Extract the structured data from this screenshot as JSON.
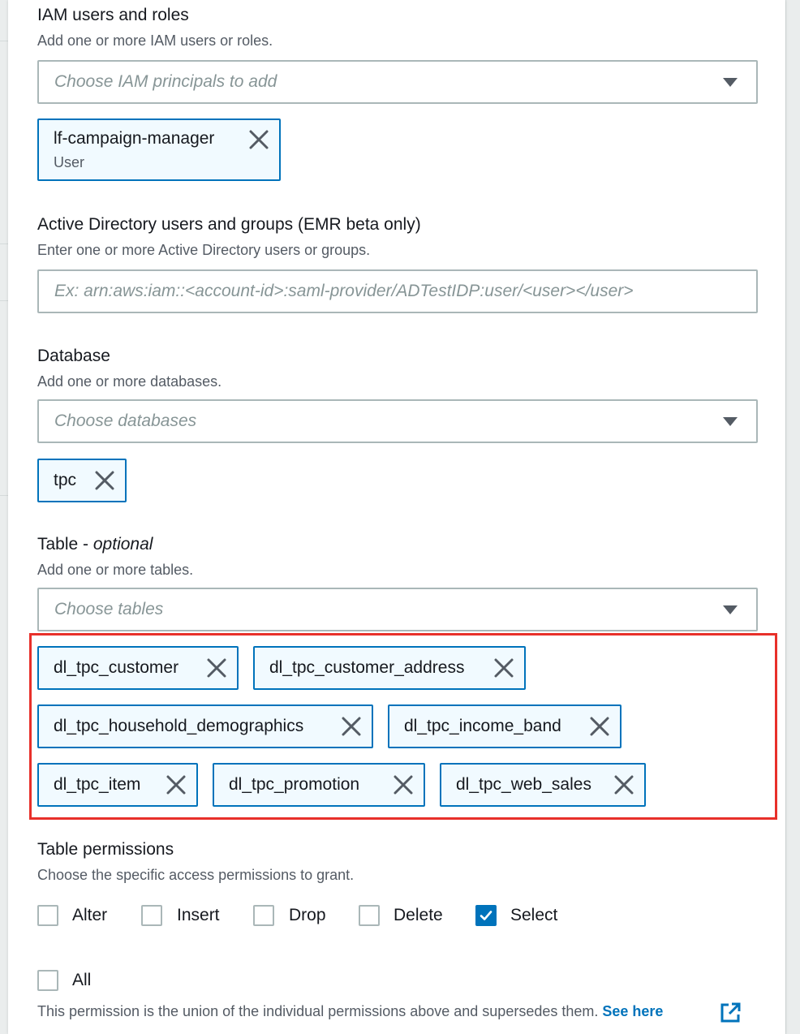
{
  "iam": {
    "label": "IAM users and roles",
    "description": "Add one or more IAM users or roles.",
    "placeholder": "Choose IAM principals to add",
    "tokens": [
      {
        "name": "lf-campaign-manager",
        "type": "User"
      }
    ]
  },
  "ad": {
    "label": "Active Directory users and groups (EMR beta only)",
    "description": "Enter one or more Active Directory users or groups.",
    "placeholder": "Ex: arn:aws:iam::<account-id>:saml-provider/ADTestIDP:user/<user></user>"
  },
  "database": {
    "label": "Database",
    "description": "Add one or more databases.",
    "placeholder": "Choose databases",
    "tokens": [
      "tpc"
    ]
  },
  "table": {
    "label": "Table - ",
    "label_optional": "optional",
    "description": "Add one or more tables.",
    "placeholder": "Choose tables",
    "tokens": [
      "dl_tpc_customer",
      "dl_tpc_customer_address",
      "dl_tpc_household_demographics",
      "dl_tpc_income_band",
      "dl_tpc_item",
      "dl_tpc_promotion",
      "dl_tpc_web_sales"
    ]
  },
  "permissions": {
    "label": "Table permissions",
    "description": "Choose the specific access permissions to grant.",
    "options": [
      {
        "label": "Alter",
        "checked": false
      },
      {
        "label": "Insert",
        "checked": false
      },
      {
        "label": "Drop",
        "checked": false
      },
      {
        "label": "Delete",
        "checked": false
      },
      {
        "label": "Select",
        "checked": true
      }
    ],
    "all": {
      "label": "All",
      "checked": false
    },
    "note": "This permission is the union of the individual permissions above and supersedes them. ",
    "link": "See here",
    "link_icon": "external-link-icon"
  },
  "colors": {
    "accent": "#0073bb",
    "token_bg": "#f1faff",
    "highlight": "#e8302a",
    "border": "#aab7b8"
  }
}
